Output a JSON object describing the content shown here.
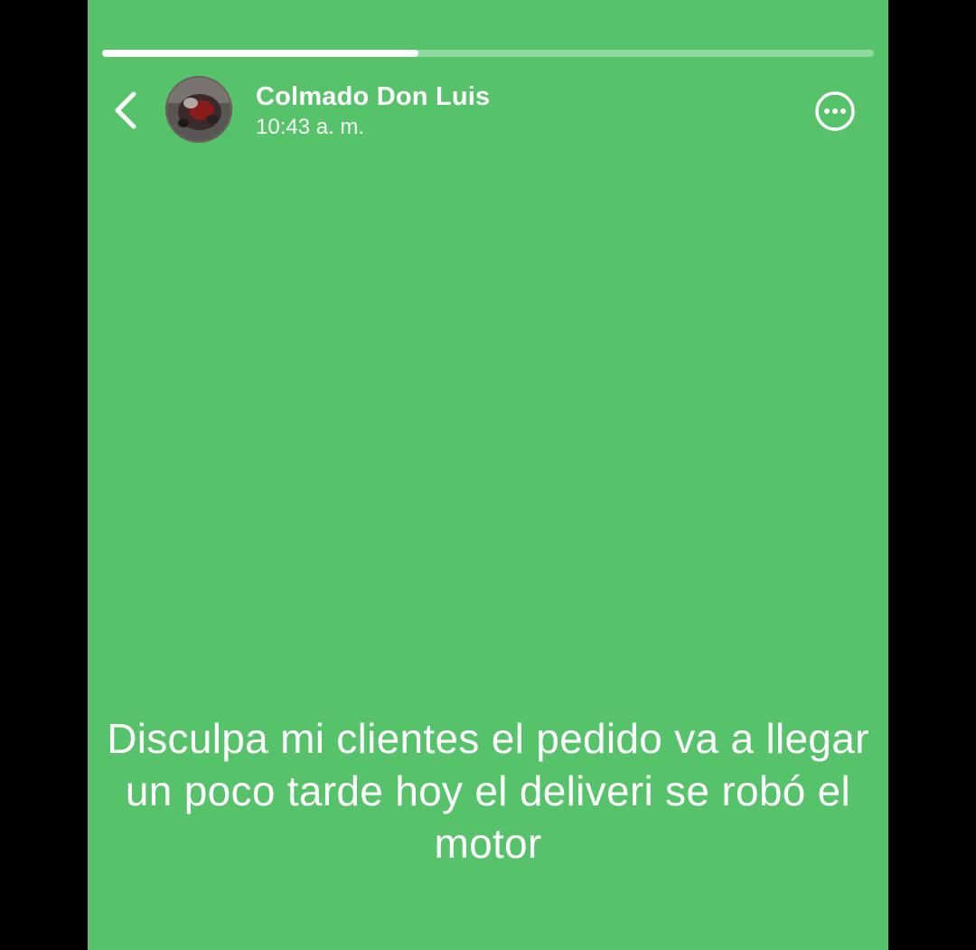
{
  "colors": {
    "background": "#000000",
    "story_background": "#56c36a",
    "text": "#ffffff"
  },
  "story": {
    "progress_fraction": 0.41
  },
  "header": {
    "back_icon": "chevron-left-icon",
    "avatar_icon": "avatar-photo",
    "contact_name": "Colmado Don Luis",
    "timestamp": "10:43 a. m.",
    "more_icon": "more-options-icon"
  },
  "status": {
    "text": "Disculpa mi clientes el pedido va a llegar un poco tarde hoy el deliveri se robó el motor"
  }
}
